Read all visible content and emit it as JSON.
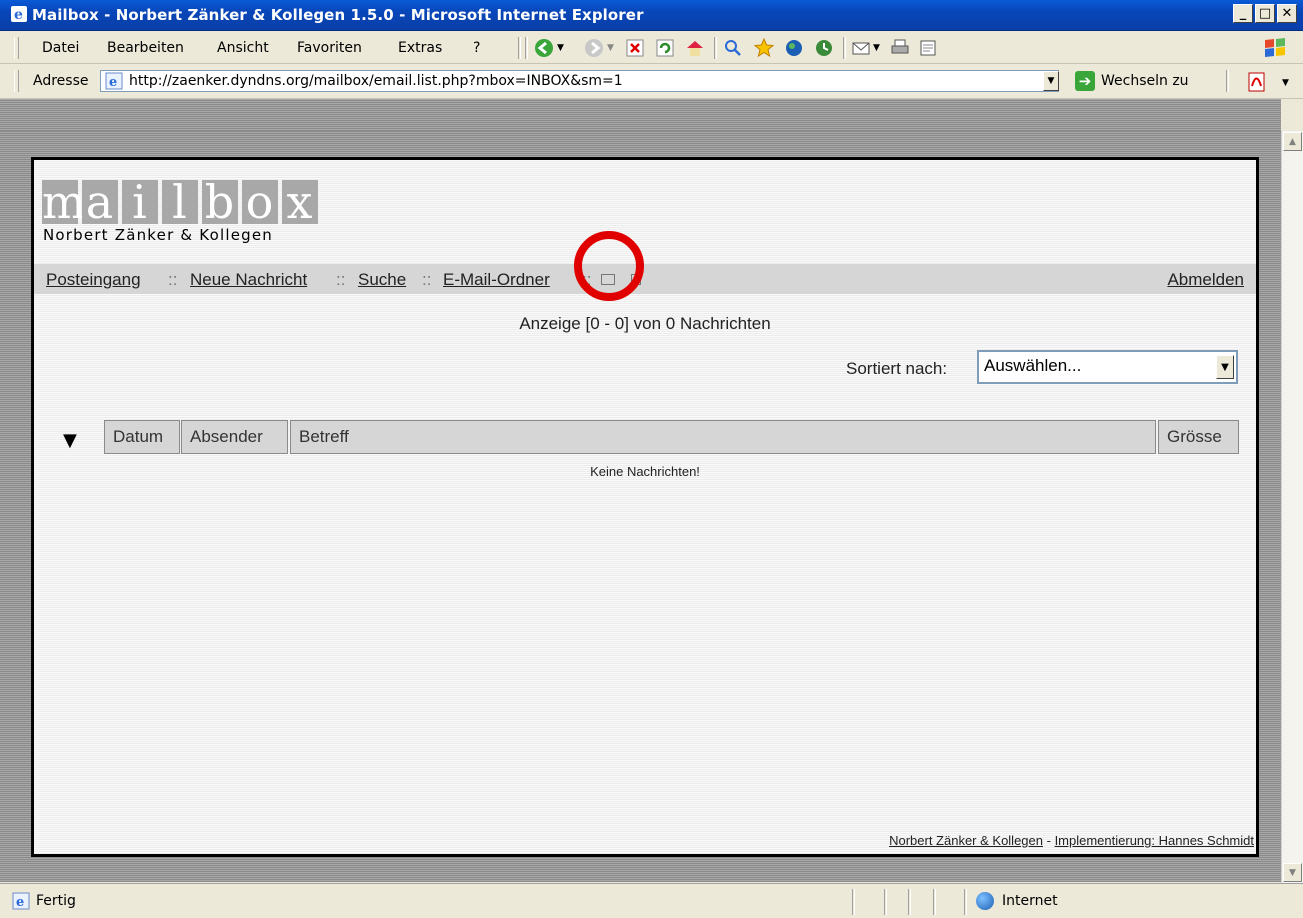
{
  "window": {
    "title": "Mailbox - Norbert Zänker & Kollegen 1.5.0 - Microsoft Internet Explorer"
  },
  "menu": [
    "Datei",
    "Bearbeiten",
    "Ansicht",
    "Favoriten",
    "Extras",
    "?"
  ],
  "address": {
    "label": "Adresse",
    "url": "http://zaenker.dyndns.org/mailbox/email.list.php?mbox=INBOX&sm=1",
    "go_label": "Wechseln zu"
  },
  "page": {
    "logo_letters": [
      "m",
      "a",
      "i",
      "l",
      "b",
      "o",
      "x"
    ],
    "company": "Norbert Zänker & Kollegen",
    "nav": {
      "inbox": "Posteingang",
      "new": "Neue Nachricht",
      "search": "Suche",
      "folders": "E-Mail-Ordner",
      "sep": "::",
      "logout": "Abmelden"
    },
    "count_text": "Anzeige [0 - 0] von 0 Nachrichten",
    "sort_label": "Sortiert nach:",
    "sort_value": "Auswählen...",
    "sort_arrow": "▼",
    "columns": {
      "date": "Datum",
      "sender": "Absender",
      "subject": "Betreff",
      "size": "Grösse"
    },
    "empty_text": "Keine Nachrichten!",
    "footer": {
      "company": "Norbert Zänker & Kollegen",
      "sep": " - ",
      "impl": "Implementierung: Hannes Schmidt"
    }
  },
  "status": {
    "text": "Fertig",
    "zone": "Internet"
  },
  "colors": {
    "titlebar": "#0a5ad6",
    "highlight_ring": "#e00000",
    "nav_bg": "#d6d6d6"
  }
}
